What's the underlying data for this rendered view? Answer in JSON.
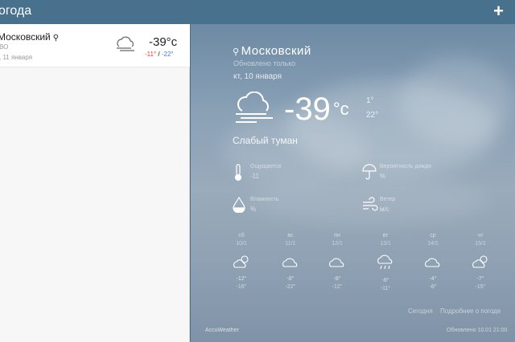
{
  "header": {
    "title": "огода",
    "add_label": "+"
  },
  "list": {
    "items": [
      {
        "city": "Московский",
        "sub": "ВО",
        "date": ", 11 января",
        "temp": "-39°с",
        "hi": "-11°",
        "lo": "-22°"
      }
    ]
  },
  "detail": {
    "city": "Московский",
    "updated": "Обновлено только",
    "date": "кт, 10 января",
    "temp": "-39",
    "unit": "°c",
    "hi": "1°",
    "lo": "22°",
    "desc": "Слабый туман",
    "metrics": [
      {
        "label": "Ощущается",
        "value": "-11",
        "icon": "thermometer-icon"
      },
      {
        "label": "Вероятность дождя",
        "value": "%",
        "icon": "umbrella-icon"
      },
      {
        "label": "Влажность",
        "value": "%",
        "icon": "humidity-icon"
      },
      {
        "label": "Ветер",
        "value": "м/с",
        "icon": "wind-icon"
      }
    ],
    "forecast": [
      {
        "day": "сб",
        "date": "10/1",
        "hi": "-12°",
        "lo": "-16°",
        "icon": "partly-cloudy-icon"
      },
      {
        "day": "вс",
        "date": "11/1",
        "hi": "-8°",
        "lo": "-22°",
        "icon": "cloudy-icon"
      },
      {
        "day": "пн",
        "date": "12/1",
        "hi": "-8°",
        "lo": "-12°",
        "icon": "cloudy-icon"
      },
      {
        "day": "вт",
        "date": "13/1",
        "hi": "-8°",
        "lo": "-11°",
        "icon": "rain-icon"
      },
      {
        "day": "ср",
        "date": "14/1",
        "hi": "-4°",
        "lo": "-8°",
        "icon": "cloudy-icon"
      },
      {
        "day": "чт",
        "date": "15/1",
        "hi": "-7°",
        "lo": "-15°",
        "icon": "partly-cloudy-icon"
      }
    ],
    "links": {
      "today": "Сегодня",
      "more": "Подробнее о погоде"
    },
    "footer": {
      "logo": "AccuWeather",
      "updated": "Обновлено 10.01 21:00"
    }
  }
}
